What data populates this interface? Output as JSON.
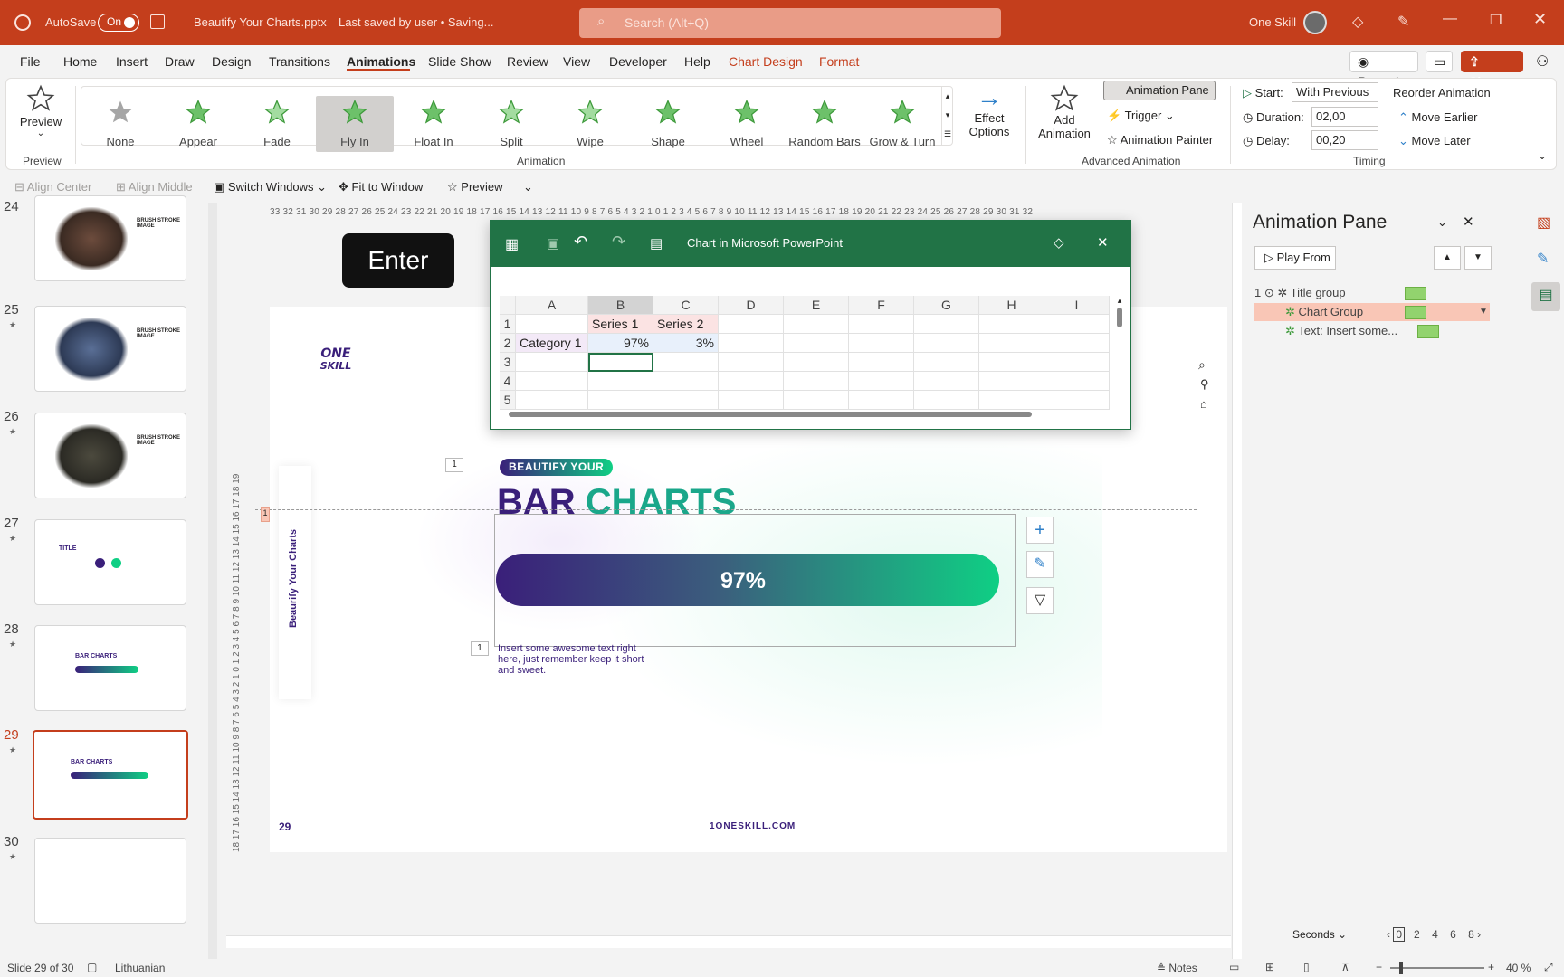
{
  "titlebar": {
    "autosave_label": "AutoSave",
    "autosave_state": "On",
    "filename": "Beautify Your Charts.pptx",
    "save_status": "Last saved by user • Saving...",
    "search_placeholder": "Search (Alt+Q)",
    "account": "One Skill"
  },
  "tabs": [
    "File",
    "Home",
    "Insert",
    "Draw",
    "Design",
    "Transitions",
    "Animations",
    "Slide Show",
    "Review",
    "View",
    "Developer",
    "Help",
    "Chart Design",
    "Format"
  ],
  "active_tab": "Animations",
  "top_buttons": {
    "record": "Record",
    "share": "Share"
  },
  "ribbon": {
    "preview_label": "Preview",
    "preview_group": "Preview",
    "animations": [
      "None",
      "Appear",
      "Fade",
      "Fly In",
      "Float In",
      "Split",
      "Wipe",
      "Shape",
      "Wheel",
      "Random Bars",
      "Grow & Turn"
    ],
    "selected_animation": "Fly In",
    "animation_group": "Animation",
    "effect_options": "Effect Options",
    "add_animation": "Add Animation",
    "animation_pane_btn": "Animation Pane",
    "trigger": "Trigger",
    "animation_painter": "Animation Painter",
    "advanced_group": "Advanced Animation",
    "start_label": "Start:",
    "start_value": "With Previous",
    "duration_label": "Duration:",
    "duration_value": "02,00",
    "delay_label": "Delay:",
    "delay_value": "00,20",
    "timing_group": "Timing",
    "reorder_title": "Reorder Animation",
    "move_earlier": "Move Earlier",
    "move_later": "Move Later"
  },
  "qat": {
    "align_center": "Align Center",
    "align_middle": "Align Middle",
    "switch_windows": "Switch Windows",
    "fit_to_window": "Fit to Window",
    "preview": "Preview"
  },
  "thumbnails": [
    {
      "num": "24",
      "text": "BRUSH STROKE IMAGE"
    },
    {
      "num": "25",
      "text": "BRUSH STROKE IMAGE"
    },
    {
      "num": "26",
      "text": "BRUSH STROKE IMAGE"
    },
    {
      "num": "27",
      "text": "TITLE"
    },
    {
      "num": "28",
      "text": "BAR CHARTS"
    },
    {
      "num": "29",
      "text": "BAR CHARTS"
    },
    {
      "num": "30",
      "text": ""
    }
  ],
  "ruler_top": "33 32 31 30 29 28 27 26 25 24 23 22 21 20 19 18 17 16 15 14 13 12 11 10 9 8 7 6 5 4 3 2 1 0 1 2 3 4 5 6 7 8 9 10 11 12 13 14 15 16 17 18 19 20 21 22 23 24 25 26 27 28 29 30 31 32",
  "enter_key": "Enter",
  "excel": {
    "title": "Chart in Microsoft PowerPoint",
    "columns": [
      "A",
      "B",
      "C",
      "D",
      "E",
      "F",
      "G",
      "H",
      "I"
    ],
    "rows": [
      "1",
      "2",
      "3",
      "4",
      "5"
    ],
    "b1": "Series 1",
    "c1": "Series 2",
    "a2": "Category 1",
    "b2": "97%",
    "c2": "3%"
  },
  "slide": {
    "logo_line1": "ONE",
    "logo_line2": "SKILL",
    "side_title": "Beaurify Your Charts",
    "pill": "BEAUTIFY YOUR",
    "heading_part1": "BAR",
    "heading_part2": "CHARTS",
    "bar_value": "97%",
    "body": "Insert some awesome text right here, just remember keep it short and sweet.",
    "page_number": "29",
    "footer": "1ONESKILL.COM",
    "anim_tag_1": "1",
    "anim_tag_2": "1",
    "anim_tag_3": "1",
    "chart_data": {
      "type": "bar",
      "categories": [
        "Category 1"
      ],
      "series": [
        {
          "name": "Series 1",
          "values": [
            97
          ]
        },
        {
          "name": "Series 2",
          "values": [
            3
          ]
        }
      ]
    }
  },
  "pane": {
    "title": "Animation Pane",
    "play_from": "Play From",
    "index": "1",
    "items": [
      "Title group",
      "Chart Group",
      "Text: Insert some..."
    ],
    "selected": "Chart Group",
    "seconds": "Seconds",
    "scale": [
      "0",
      "2",
      "4",
      "6",
      "8"
    ]
  },
  "status": {
    "slide_info": "Slide 29 of 30",
    "language": "Lithuanian",
    "notes": "Notes",
    "zoom": "40 %"
  }
}
